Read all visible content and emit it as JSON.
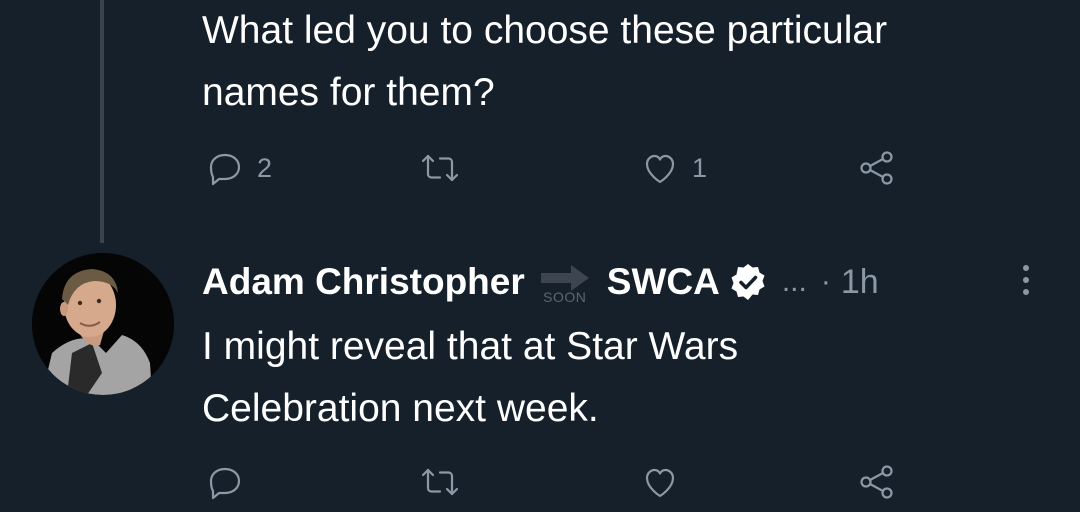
{
  "previous_tweet": {
    "text_line1": "What led you to choose these particular",
    "text_line2": "names for them?",
    "reply_count": "2",
    "retweet_count": "",
    "like_count": "1"
  },
  "tweet": {
    "author_name": "Adam Christopher",
    "badge_label": "SOON",
    "author_name_2": "SWCA",
    "truncation": "...",
    "separator": "·",
    "timestamp": "1h",
    "text_line1": "I might reveal that at Star Wars",
    "text_line2": "Celebration next week.",
    "reply_count": "",
    "retweet_count": "",
    "like_count": ""
  },
  "icons": {
    "reply": "reply-icon",
    "retweet": "retweet-icon",
    "like": "heart-icon",
    "share": "share-icon",
    "verified": "verified-badge-icon",
    "more": "more-options-icon"
  },
  "colors": {
    "background": "#15202b",
    "text": "#ffffff",
    "muted": "#8b98a5",
    "thread_line": "#38444d"
  }
}
